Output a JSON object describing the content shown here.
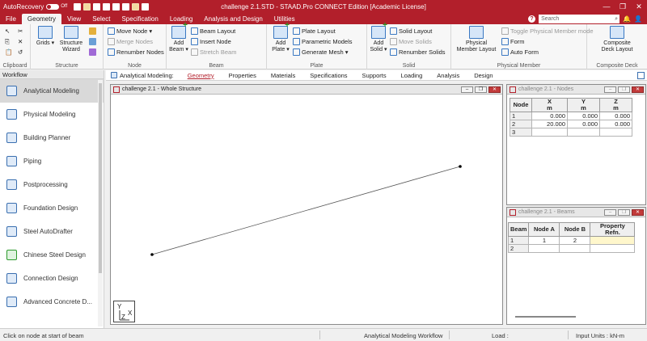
{
  "titlebar": {
    "autorecovery_label": "AutoRecovery",
    "toggle_state": "Off",
    "title": "challenge 2.1.STD - STAAD.Pro CONNECT Edition [Academic License]"
  },
  "ribbon_tabs": [
    {
      "label": "File",
      "active": false
    },
    {
      "label": "Geometry",
      "active": true
    },
    {
      "label": "View",
      "active": false
    },
    {
      "label": "Select",
      "active": false
    },
    {
      "label": "Specification",
      "active": false
    },
    {
      "label": "Loading",
      "active": false
    },
    {
      "label": "Analysis and Design",
      "active": false
    },
    {
      "label": "Utilities",
      "active": false
    }
  ],
  "search": {
    "placeholder": "Search"
  },
  "ribbon": {
    "clipboard": {
      "label": "Clipboard"
    },
    "structure": {
      "label": "Structure",
      "grids": "Grids",
      "wizard_line1": "Structure",
      "wizard_line2": "Wizard"
    },
    "node": {
      "label": "Node",
      "move": "Move Node",
      "merge": "Merge Nodes",
      "renumber": "Renumber Nodes"
    },
    "beam": {
      "label": "Beam",
      "add_line1": "Add",
      "add_line2": "Beam",
      "layout": "Beam Layout",
      "insert": "Insert Node",
      "stretch": "Stretch Beam"
    },
    "plate": {
      "label": "Plate",
      "add_line1": "Add",
      "add_line2": "Plate",
      "layout": "Plate Layout",
      "parametric": "Parametric Models",
      "mesh": "Generate Mesh"
    },
    "solid": {
      "label": "Solid",
      "add_line1": "Add",
      "add_line2": "Solid",
      "layout": "Solid Layout",
      "move": "Move Solids",
      "renumber": "Renumber Solids"
    },
    "physical_member": {
      "label": "Physical Member",
      "layout_line1": "Physical",
      "layout_line2": "Member Layout",
      "toggle": "Toggle Physical Member mode",
      "form": "Form",
      "auto_form": "Auto Form"
    },
    "composite": {
      "label": "Composite Deck",
      "layout_line1": "Composite",
      "layout_line2": "Deck Layout"
    }
  },
  "workflow": {
    "header": "Workflow",
    "items": [
      {
        "label": "Analytical Modeling",
        "active": true
      },
      {
        "label": "Physical Modeling",
        "active": false
      },
      {
        "label": "Building Planner",
        "active": false
      },
      {
        "label": "Piping",
        "active": false
      },
      {
        "label": "Postprocessing",
        "active": false
      },
      {
        "label": "Foundation Design",
        "active": false
      },
      {
        "label": "Steel AutoDrafter",
        "active": false
      },
      {
        "label": "Chinese Steel Design",
        "active": false
      },
      {
        "label": "Connection Design",
        "active": false
      },
      {
        "label": "Advanced Concrete D...",
        "active": false
      }
    ]
  },
  "subtabs": {
    "label": "Analytical Modeling:",
    "tabs": [
      {
        "label": "Geometry",
        "active": true
      },
      {
        "label": "Properties",
        "active": false
      },
      {
        "label": "Materials",
        "active": false
      },
      {
        "label": "Specifications",
        "active": false
      },
      {
        "label": "Supports",
        "active": false
      },
      {
        "label": "Loading",
        "active": false
      },
      {
        "label": "Analysis",
        "active": false
      },
      {
        "label": "Design",
        "active": false
      }
    ]
  },
  "structure_window": {
    "title": "challenge 2.1 - Whole Structure",
    "axis": {
      "y": "Y",
      "x": "X",
      "z": "Z"
    }
  },
  "nodes_window": {
    "title": "challenge 2.1 - Nodes",
    "headers": [
      {
        "name": "Node",
        "unit": ""
      },
      {
        "name": "X",
        "unit": "m"
      },
      {
        "name": "Y",
        "unit": "m"
      },
      {
        "name": "Z",
        "unit": "m"
      }
    ],
    "rows": [
      {
        "id": "1",
        "x": "0.000",
        "y": "0.000",
        "z": "0.000"
      },
      {
        "id": "2",
        "x": "20.000",
        "y": "0.000",
        "z": "0.000"
      },
      {
        "id": "3",
        "x": "",
        "y": "",
        "z": ""
      }
    ]
  },
  "beams_window": {
    "title": "challenge 2.1 - Beams",
    "headers": [
      "Beam",
      "Node A",
      "Node B",
      "Property Refn."
    ],
    "rows": [
      {
        "id": "1",
        "a": "1",
        "b": "2",
        "prop": ""
      },
      {
        "id": "2",
        "a": "",
        "b": "",
        "prop": ""
      }
    ]
  },
  "statusbar": {
    "message": "Click on node at start of beam",
    "workflow": "Analytical Modeling Workflow",
    "load": "Load :",
    "units": "Input Units : kN-m"
  }
}
